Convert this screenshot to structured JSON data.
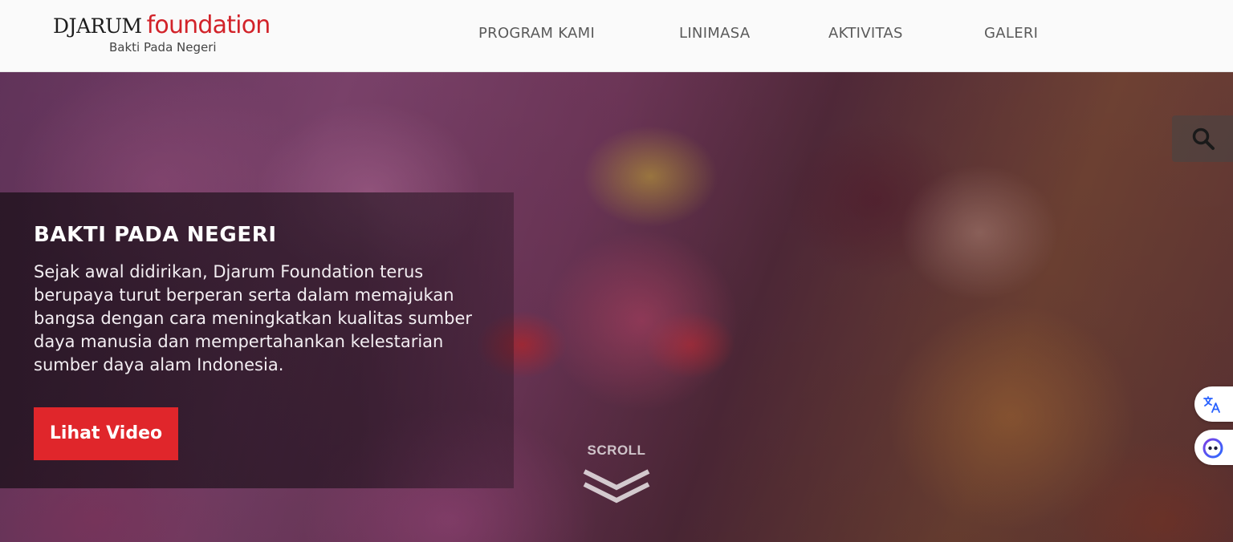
{
  "brand": {
    "name_part1": "DJARUM",
    "name_part2": "foundation",
    "tagline": "Bakti Pada Negeri",
    "accent_color": "#d2232a"
  },
  "nav": {
    "items": [
      {
        "label": "PROGRAM KAMI"
      },
      {
        "label": "LINIMASA"
      },
      {
        "label": "AKTIVITAS"
      },
      {
        "label": "GALERI"
      }
    ]
  },
  "hero": {
    "title": "BAKTI PADA NEGERI",
    "description": "Sejak awal didirikan, Djarum Foundation terus berupaya turut berperan serta dalam memajukan bangsa dengan cara meningkatkan kualitas sumber daya manusia dan mempertahankan kelestarian sumber daya alam Indonesia.",
    "cta_label": "Lihat Video",
    "cta_color": "#e0262b",
    "scroll_label": "SCROLL"
  },
  "widgets": {
    "search_icon": "search-icon",
    "translate_icon": "translate-icon",
    "assistant_icon": "assistant-icon"
  }
}
